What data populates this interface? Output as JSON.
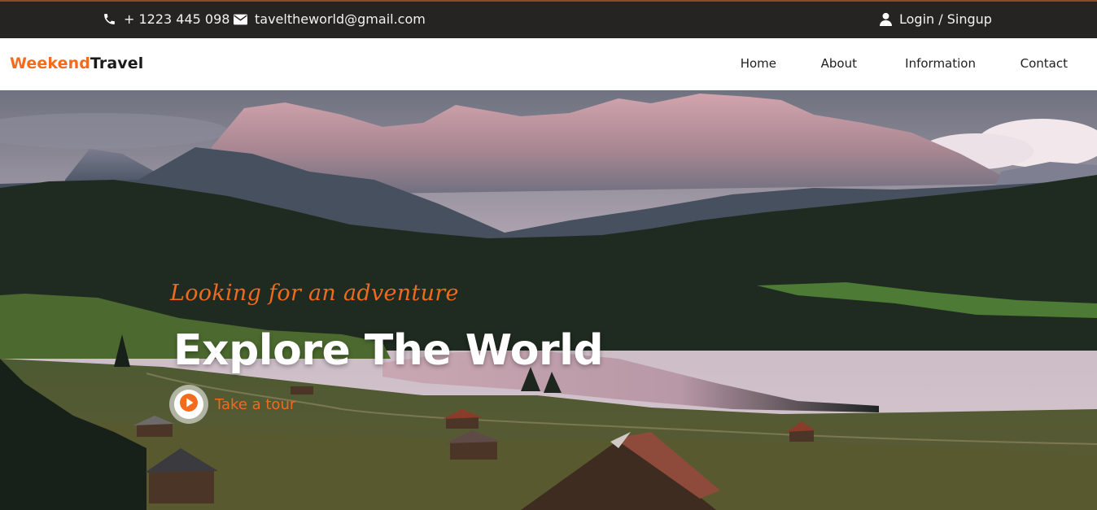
{
  "topbar": {
    "phone": "+ 1223 445 098",
    "email": "taveltheworld@gmail.com",
    "login": "Login / Singup",
    "icons": {
      "phone": "phone-icon",
      "email": "envelope-icon",
      "login": "user-icon"
    }
  },
  "brand": {
    "part1": "Weekend",
    "part2": "Travel"
  },
  "nav": {
    "items": [
      "Home",
      "About",
      "Information",
      "Contact"
    ]
  },
  "hero": {
    "tagline": "Looking for an adventure",
    "headline": "Explore The World",
    "cta": "Take a tour",
    "cta_icon": "play-icon"
  },
  "colors": {
    "accent": "#f36b1c",
    "topbar": "#252422",
    "nav_bg": "#ffffff",
    "text_dark": "#1a1a1a"
  }
}
